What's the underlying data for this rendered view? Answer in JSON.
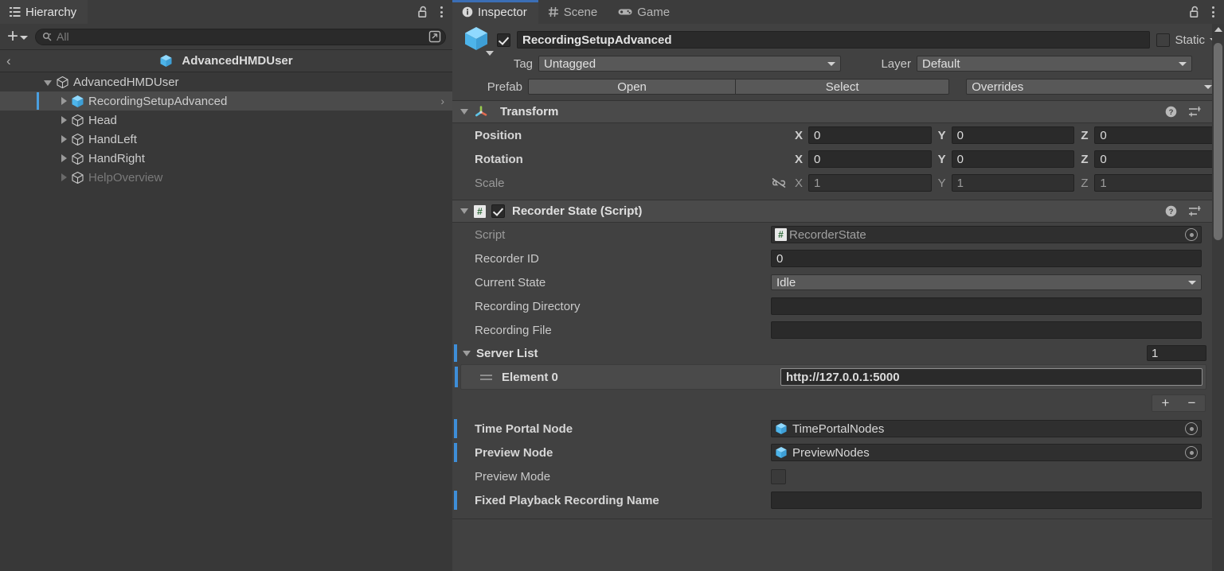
{
  "hierarchy": {
    "tab_label": "Hierarchy",
    "lock_icon": "padlock-open-icon",
    "menu_icon": "kebab-menu-icon",
    "add_label": "+",
    "search": {
      "placeholder": "All",
      "value": "",
      "icon": "search-icon"
    },
    "breadcrumb": {
      "back_glyph": "‹",
      "label": "AdvancedHMDUser",
      "icon": "prefab-cube-icon"
    },
    "rows": [
      {
        "label": "AdvancedHMDUser",
        "depth": 1,
        "expanded": true,
        "icon": "gameobject-cube-icon",
        "selected": false,
        "dim": false,
        "chevron": false
      },
      {
        "label": "RecordingSetupAdvanced",
        "depth": 2,
        "expanded": false,
        "icon": "prefab-cube-icon",
        "selected": true,
        "dim": false,
        "chevron": true
      },
      {
        "label": "Head",
        "depth": 2,
        "expanded": false,
        "icon": "gameobject-cube-icon",
        "selected": false,
        "dim": false,
        "chevron": false
      },
      {
        "label": "HandLeft",
        "depth": 2,
        "expanded": false,
        "icon": "gameobject-cube-icon",
        "selected": false,
        "dim": false,
        "chevron": false
      },
      {
        "label": "HandRight",
        "depth": 2,
        "expanded": false,
        "icon": "gameobject-cube-icon",
        "selected": false,
        "dim": false,
        "chevron": false
      },
      {
        "label": "HelpOverview",
        "depth": 2,
        "expanded": false,
        "icon": "gameobject-cube-icon",
        "selected": false,
        "dim": true,
        "chevron": false
      }
    ]
  },
  "inspector": {
    "tabs": [
      {
        "label": "Inspector",
        "icon": "info-circle-icon",
        "active": true
      },
      {
        "label": "Scene",
        "icon": "hash-grid-icon",
        "active": false
      },
      {
        "label": "Game",
        "icon": "gamepad-icon",
        "active": false
      }
    ],
    "lock_icon": "padlock-open-icon",
    "menu_icon": "kebab-menu-icon",
    "gameobject": {
      "enabled": true,
      "name": "RecordingSetupAdvanced",
      "icon": "prefab-cube-icon",
      "static_label": "Static",
      "static_checked": false,
      "tag_label": "Tag",
      "tag_value": "Untagged",
      "layer_label": "Layer",
      "layer_value": "Default",
      "prefab_label": "Prefab",
      "open_label": "Open",
      "select_label": "Select",
      "overrides_label": "Overrides"
    },
    "transform": {
      "title": "Transform",
      "icon": "transform-axis-icon",
      "expanded": true,
      "help_icon": "help-circle-icon",
      "preset_icon": "preset-sliders-icon",
      "menu_icon": "kebab-menu-icon",
      "rows": [
        {
          "label": "Position",
          "x": "0",
          "y": "0",
          "z": "0",
          "dim": false,
          "link": false
        },
        {
          "label": "Rotation",
          "x": "0",
          "y": "0",
          "z": "0",
          "dim": false,
          "link": false
        },
        {
          "label": "Scale",
          "x": "1",
          "y": "1",
          "z": "1",
          "dim": true,
          "link": true,
          "link_icon": "broken-link-icon"
        }
      ],
      "axes": [
        "X",
        "Y",
        "Z"
      ]
    },
    "recorder_state": {
      "title": "Recorder State (Script)",
      "icon": "script-hash-icon",
      "enabled": true,
      "expanded": true,
      "help_icon": "help-circle-icon",
      "preset_icon": "preset-sliders-icon",
      "menu_icon": "kebab-menu-icon",
      "fields": [
        {
          "kind": "object",
          "label": "Script",
          "value": "RecorderState",
          "label_dim": true,
          "value_dim": true,
          "override": false,
          "icon": "script-hash-icon"
        },
        {
          "kind": "text",
          "label": "Recorder ID",
          "value": "0",
          "label_dim": false,
          "override": false
        },
        {
          "kind": "dropdown",
          "label": "Current State",
          "value": "Idle",
          "label_dim": false,
          "override": false
        },
        {
          "kind": "text",
          "label": "Recording Directory",
          "value": "",
          "label_dim": false,
          "override": false
        },
        {
          "kind": "text",
          "label": "Recording File",
          "value": "",
          "label_dim": false,
          "override": false
        }
      ],
      "server_list": {
        "title": "Server List",
        "expanded": true,
        "override": true,
        "size": "1",
        "elements": [
          {
            "label": "Element 0",
            "value": "http://127.0.0.1:5000",
            "override": true,
            "handle_icon": "drag-handle-icon"
          }
        ],
        "add_label": "+",
        "remove_label": "−"
      },
      "after_fields": [
        {
          "kind": "object",
          "label": "Time Portal Node",
          "value": "TimePortalNodes",
          "bold": true,
          "override": true,
          "icon": "prefab-cube-icon"
        },
        {
          "kind": "object",
          "label": "Preview Node",
          "value": "PreviewNodes",
          "bold": true,
          "override": true,
          "icon": "prefab-cube-icon"
        },
        {
          "kind": "checkbox",
          "label": "Preview Mode",
          "checked": false,
          "bold": false,
          "override": false
        },
        {
          "kind": "text",
          "label": "Fixed Playback Recording Name",
          "value": "",
          "bold": true,
          "override": true
        }
      ]
    },
    "scrollbar": {
      "up_arrow_icon": "scroll-up-arrow-icon"
    }
  },
  "colors": {
    "panel_bg": "#414141",
    "hierarchy_bg": "#383838",
    "toolbar_bg": "#3c3c3c",
    "component_header": "#4a4a4a",
    "accent_blue": "#3e8ed8",
    "selection": "#4b4b4b",
    "field_bg": "#2a2a2a",
    "cube_blue": "#5fc4f5"
  }
}
